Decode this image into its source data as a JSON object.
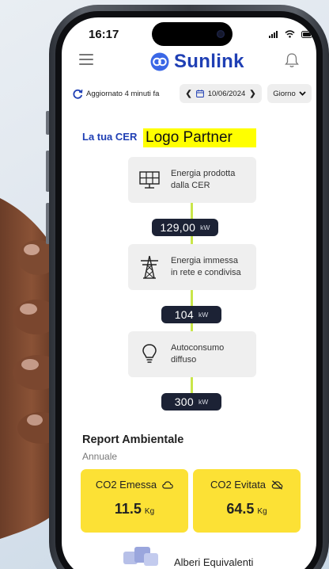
{
  "status_bar": {
    "time": "16:17"
  },
  "header": {
    "app_name": "Sunlink"
  },
  "toolbar": {
    "updated_text": "Aggiornato 4 minuti fa",
    "date": "10/06/2024",
    "period": "Giorno"
  },
  "cer": {
    "title": "La tua CER",
    "partner_logo": "Logo Partner",
    "nodes": [
      {
        "label_line1": "Energia prodotta",
        "label_line2": "dalla CER",
        "value": "129,00",
        "unit": "kW",
        "icon": "solar-panel-icon"
      },
      {
        "label_line1": "Energia immessa",
        "label_line2": "in rete e condivisa",
        "value": "104",
        "unit": "kW",
        "icon": "power-tower-icon"
      },
      {
        "label_line1": "Autoconsumo",
        "label_line2": "diffuso",
        "value": "300",
        "unit": "kW",
        "icon": "lightbulb-icon"
      }
    ]
  },
  "report": {
    "title": "Report Ambientale",
    "subtitle": "Annuale",
    "emitted": {
      "label": "CO2 Emessa",
      "value": "11.5",
      "unit": "Kg"
    },
    "avoided": {
      "label": "CO2 Evitata",
      "value": "64.5",
      "unit": "Kg"
    },
    "trees_label": "Alberi Equivalenti"
  },
  "colors": {
    "brand_blue": "#1f3fb4",
    "flow_line": "#c9e64a",
    "co2_card": "#fce135",
    "value_pill": "#1c2235"
  }
}
